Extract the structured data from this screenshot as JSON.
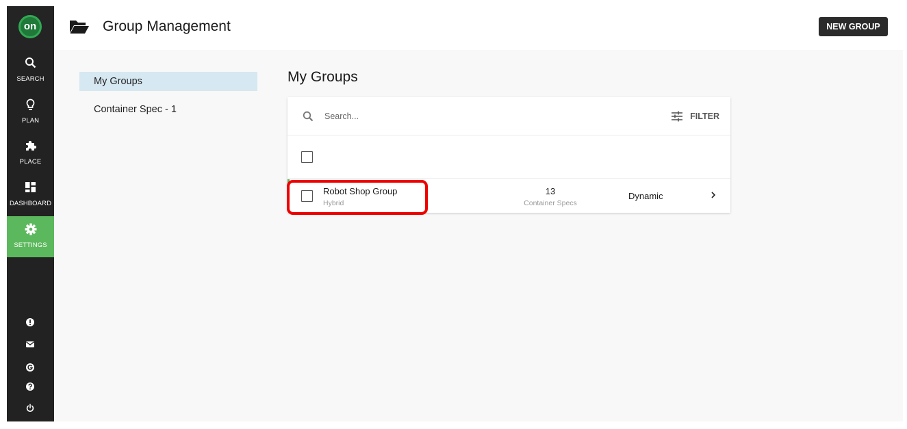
{
  "app": {
    "logo_text": "on",
    "brand_color": "#5cb85c"
  },
  "rail": {
    "items": [
      {
        "label": "SEARCH",
        "icon": "search-icon",
        "active": false
      },
      {
        "label": "PLAN",
        "icon": "lightbulb-icon",
        "active": false
      },
      {
        "label": "PLACE",
        "icon": "puzzle-icon",
        "active": false
      },
      {
        "label": "DASHBOARD",
        "icon": "dashboard-icon",
        "active": false
      },
      {
        "label": "SETTINGS",
        "icon": "gear-icon",
        "active": true
      }
    ],
    "utility_icons": [
      "alert-icon",
      "mail-icon",
      "google-icon",
      "help-icon",
      "power-icon"
    ]
  },
  "header": {
    "title": "Group Management",
    "new_group_label": "NEW GROUP",
    "icon": "folder-open-icon"
  },
  "subnav": {
    "items": [
      {
        "label": "My Groups",
        "active": true
      },
      {
        "label": "Container Spec - 1",
        "active": false
      }
    ]
  },
  "main": {
    "title": "My Groups",
    "search": {
      "placeholder": "Search...",
      "value": ""
    },
    "filter_label": "FILTER",
    "rows": [
      {
        "name": "Robot Shop Group",
        "type": "Hybrid",
        "count": "13",
        "count_label": "Container Specs",
        "membership": "Dynamic",
        "highlighted": true
      }
    ]
  },
  "colors": {
    "rail_bg": "#222222",
    "active_nav": "#5cb85c",
    "subnav_active": "#d6e8f1",
    "highlight": "#ee0000"
  }
}
